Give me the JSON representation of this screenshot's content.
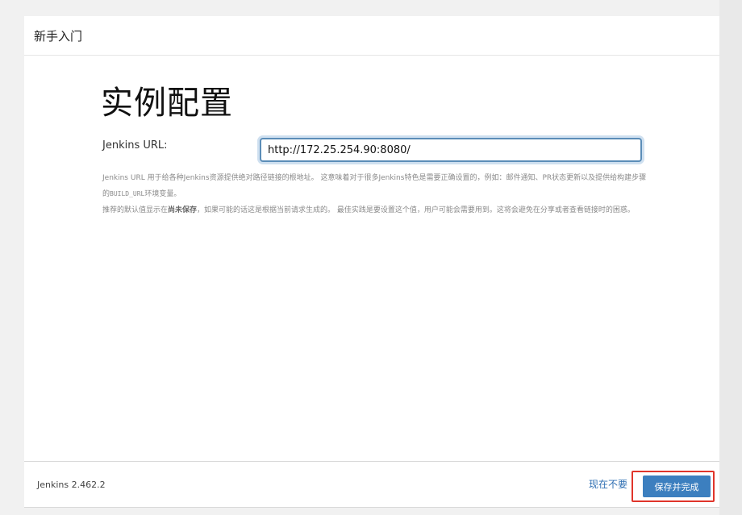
{
  "header": {
    "title": "新手入门"
  },
  "page": {
    "title": "实例配置"
  },
  "form": {
    "url_label": "Jenkins URL:",
    "url_value": "http://172.25.254.90:8080/"
  },
  "help": {
    "line1_a": "Jenkins URL 用于给各种Jenkins资源提供绝对路径链接的根地址。 这意味着对于很多Jenkins特色是需要正确设置的，例如：邮件通知、PR状态更新以及提供给构建步骤的",
    "line1_code": "BUILD_URL",
    "line1_b": "环境变量。",
    "line2_a": "推荐的默认值显示在",
    "line2_bold": "尚未保存",
    "line2_b": "，如果可能的话这是根据当前请求生成的。 最佳实践是要设置这个值，用户可能会需要用到。这将会避免在分享或者查看链接时的困惑。"
  },
  "footer": {
    "version": "Jenkins 2.462.2",
    "skip_label": "现在不要",
    "save_label": "保存并完成"
  }
}
